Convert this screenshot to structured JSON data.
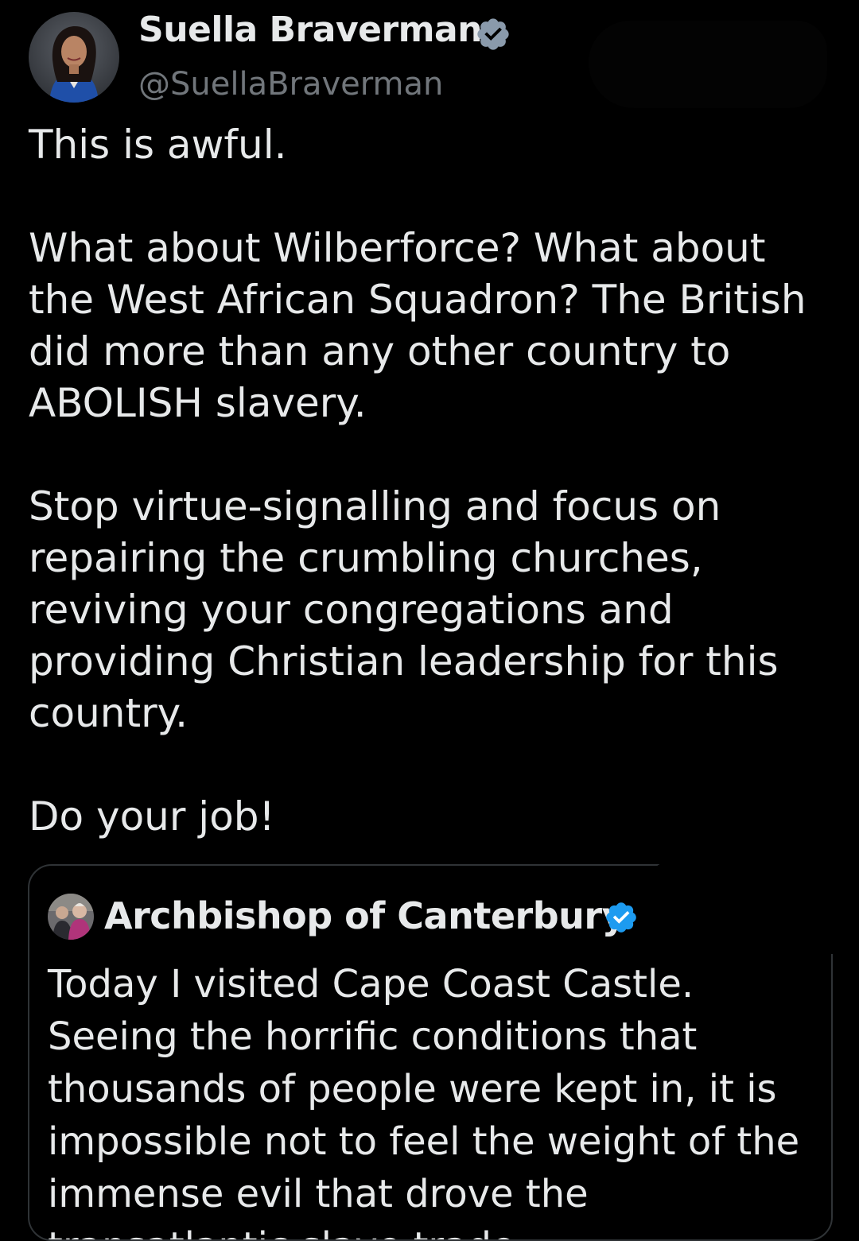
{
  "tweet": {
    "author": {
      "name": "Suella Braverman",
      "handle": "@SuellaBraverman",
      "verified": true,
      "verified_icon": "verified-badge-icon",
      "verified_color": "#8a9aab"
    },
    "body": [
      "This is awful.",
      "What about Wilberforce? What about the West African Squadron? The British did more than any other country to ABOLISH slavery.",
      "Stop virtue-signalling and focus on repairing the crumbling churches, reviving your congregations and providing Christian leadership for this country.",
      "Do your job!"
    ],
    "quoted": {
      "author": {
        "name": "Archbishop of Canterbury",
        "verified": true,
        "verified_icon": "verified-badge-icon",
        "verified_color": "#1d9bf0"
      },
      "text": "Today I visited Cape Coast Castle. Seeing the horrific conditions that thousands of people were kept in, it is impossible not to feel the weight of the immense evil that drove the transatlantic slave trade...."
    }
  },
  "theme": {
    "background": "#000000",
    "text": "#e7e9ea",
    "secondary_text": "#71767b",
    "border": "#2f3336"
  }
}
